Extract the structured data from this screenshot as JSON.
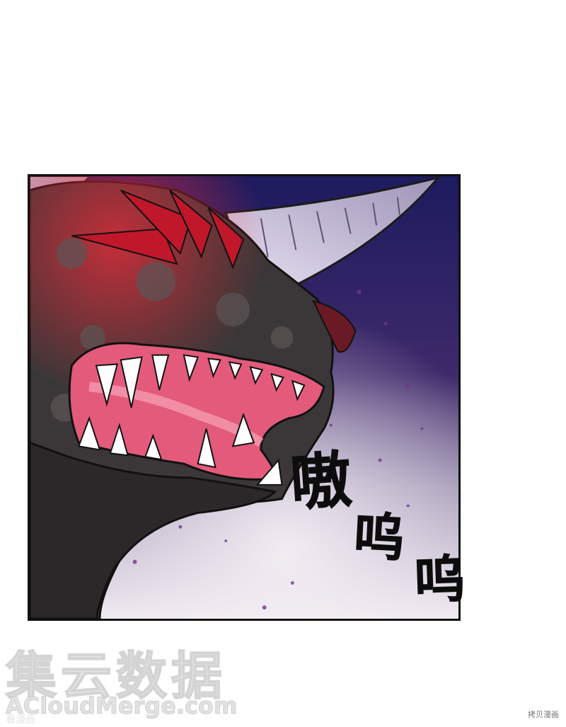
{
  "panel": {
    "description_colors": {
      "sky_top": "#1e1a5a",
      "sky_mid": "#4a2f6e",
      "mist": "#d8cfe0",
      "dragon_skin": "#3a3536",
      "mouth": "#e76a86",
      "horn": "#c9c1d6",
      "spikes": "#c0172a"
    }
  },
  "sfx": {
    "char1": "嗷",
    "char2": "呜",
    "char3": "呜"
  },
  "watermark": {
    "chinese": "集云数据",
    "english": "ACloudMerge.com",
    "small": "看漫画",
    "corner": "拷贝漫画"
  }
}
